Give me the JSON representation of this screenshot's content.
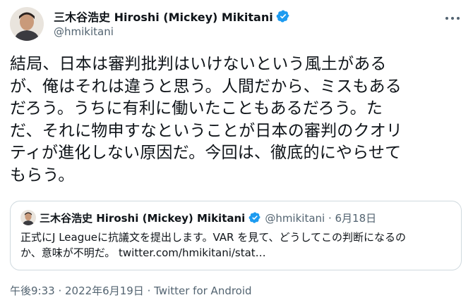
{
  "author": {
    "display_name": "三木谷浩史 Hiroshi (Mickey) Mikitani",
    "handle": "@hmikitani",
    "verified": true
  },
  "tweet": {
    "lines": [
      "結局、日本は審判批判はいけないという風土がある",
      "が、俺はそれは違うと思う。人間だから、ミスもある",
      "だろう。うちに有利に働いたこともあるだろう。た",
      "だ、それに物申すなということが日本の審判のクオリ",
      "ティが進化しない原因だ。今回は、徹底的にやらせて",
      "もらう。"
    ]
  },
  "quoted_tweet": {
    "display_name": "三木谷浩史 Hiroshi (Mickey) Mikitani",
    "meta": "@hmikitani · 6月18日",
    "lines": [
      "正式にJ Leagueに抗議文を提出します。VAR を見て、どうしてこの判断になるの",
      "か、意味が不明だ。 twitter.com/hmikitani/stat…"
    ]
  },
  "footer": {
    "time": "午後9:33",
    "date": "2022年6月19日",
    "separator": " · ",
    "source": "Twitter for Android"
  },
  "icons": {
    "verified": "verified-badge-icon",
    "more": "more-dots-icon"
  },
  "colors": {
    "text": "#0f1419",
    "secondary": "#536471",
    "verified": "#1d9bf0",
    "border": "#cfd9de"
  }
}
